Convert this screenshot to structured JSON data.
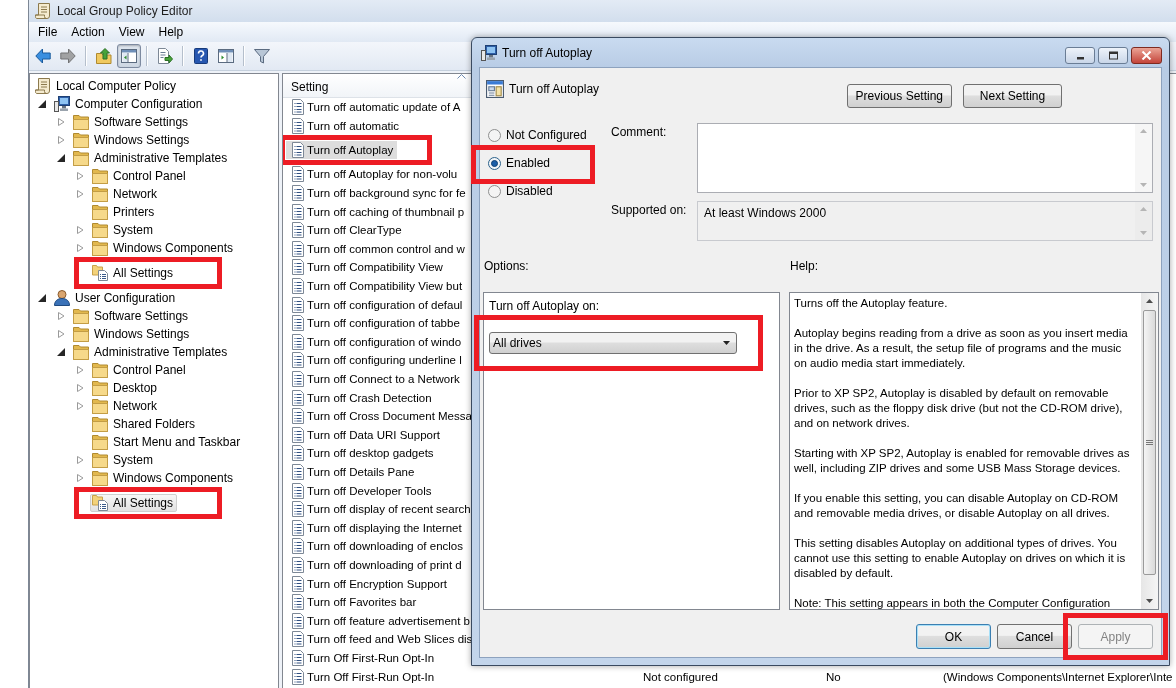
{
  "window": {
    "title": "Local Group Policy Editor"
  },
  "menu": [
    "File",
    "Action",
    "View",
    "Help"
  ],
  "toolbar_groups": [
    [
      {
        "kind": "back",
        "disabled": false,
        "pressed": false
      },
      {
        "kind": "forward",
        "disabled": true,
        "pressed": false
      }
    ],
    [
      {
        "kind": "up",
        "disabled": false,
        "pressed": false
      },
      {
        "kind": "console-tree",
        "disabled": false,
        "pressed": true
      }
    ],
    [
      {
        "kind": "export",
        "disabled": false,
        "pressed": false
      }
    ],
    [
      {
        "kind": "help",
        "disabled": false,
        "pressed": false
      },
      {
        "kind": "action-pane",
        "disabled": false,
        "pressed": false
      }
    ],
    [
      {
        "kind": "filter",
        "disabled": false,
        "pressed": false
      }
    ]
  ],
  "tree": [
    {
      "label": "Local Computer Policy",
      "kind": "policy",
      "selected": false,
      "highlighted": false,
      "children": [
        {
          "label": "Computer Configuration",
          "kind": "computer",
          "expanded": true,
          "selected": false,
          "highlighted": false,
          "children": [
            {
              "label": "Software Settings",
              "kind": "folder",
              "expanded": false,
              "selected": false,
              "highlighted": false
            },
            {
              "label": "Windows Settings",
              "kind": "folder",
              "expanded": false,
              "selected": false,
              "highlighted": false
            },
            {
              "label": "Administrative Templates",
              "kind": "folder",
              "expanded": true,
              "selected": false,
              "highlighted": false,
              "children": [
                {
                  "label": "Control Panel",
                  "kind": "folder",
                  "expanded": false,
                  "selected": false,
                  "highlighted": false
                },
                {
                  "label": "Network",
                  "kind": "folder",
                  "expanded": false,
                  "selected": false,
                  "highlighted": false
                },
                {
                  "label": "Printers",
                  "kind": "folder",
                  "selected": false,
                  "highlighted": false
                },
                {
                  "label": "System",
                  "kind": "folder",
                  "expanded": false,
                  "selected": false,
                  "highlighted": false
                },
                {
                  "label": "Windows Components",
                  "kind": "folder",
                  "expanded": false,
                  "selected": false,
                  "highlighted": false
                },
                {
                  "label": "All Settings",
                  "kind": "all-settings",
                  "selected": false,
                  "highlighted": true
                }
              ]
            }
          ]
        },
        {
          "label": "User Configuration",
          "kind": "user",
          "expanded": true,
          "selected": false,
          "highlighted": false,
          "children": [
            {
              "label": "Software Settings",
              "kind": "folder",
              "expanded": false,
              "selected": false,
              "highlighted": false
            },
            {
              "label": "Windows Settings",
              "kind": "folder",
              "expanded": false,
              "selected": false,
              "highlighted": false
            },
            {
              "label": "Administrative Templates",
              "kind": "folder",
              "expanded": true,
              "selected": false,
              "highlighted": false,
              "children": [
                {
                  "label": "Control Panel",
                  "kind": "folder",
                  "expanded": false,
                  "selected": false,
                  "highlighted": false
                },
                {
                  "label": "Desktop",
                  "kind": "folder",
                  "expanded": false,
                  "selected": false,
                  "highlighted": false
                },
                {
                  "label": "Network",
                  "kind": "folder",
                  "expanded": false,
                  "selected": false,
                  "highlighted": false
                },
                {
                  "label": "Shared Folders",
                  "kind": "folder",
                  "selected": false,
                  "highlighted": false
                },
                {
                  "label": "Start Menu and Taskbar",
                  "kind": "folder",
                  "selected": false,
                  "highlighted": false
                },
                {
                  "label": "System",
                  "kind": "folder",
                  "expanded": false,
                  "selected": false,
                  "highlighted": false
                },
                {
                  "label": "Windows Components",
                  "kind": "folder",
                  "expanded": false,
                  "selected": false,
                  "highlighted": false
                },
                {
                  "label": "All Settings",
                  "kind": "all-settings",
                  "selected": true,
                  "highlighted": true
                }
              ]
            }
          ]
        }
      ]
    }
  ],
  "list": {
    "columns": [
      {
        "label": "Setting",
        "sorted": true
      }
    ],
    "rows": [
      {
        "setting": "Turn off automatic update of A",
        "selected": false,
        "highlighted": false
      },
      {
        "setting": "Turn off automatic",
        "selected": false,
        "highlighted": false
      },
      {
        "setting": "Turn off Autoplay",
        "selected": true,
        "highlighted": true
      },
      {
        "setting": "Turn off Autoplay for non-volu",
        "selected": false,
        "highlighted": false
      },
      {
        "setting": "Turn off background sync for fe",
        "selected": false,
        "highlighted": false
      },
      {
        "setting": "Turn off caching of thumbnail p",
        "selected": false,
        "highlighted": false
      },
      {
        "setting": "Turn off ClearType",
        "selected": false,
        "highlighted": false
      },
      {
        "setting": "Turn off common control and w",
        "selected": false,
        "highlighted": false
      },
      {
        "setting": "Turn off Compatibility View",
        "selected": false,
        "highlighted": false
      },
      {
        "setting": "Turn off Compatibility View but",
        "selected": false,
        "highlighted": false
      },
      {
        "setting": "Turn off configuration of defaul",
        "selected": false,
        "highlighted": false
      },
      {
        "setting": "Turn off configuration of tabbe",
        "selected": false,
        "highlighted": false
      },
      {
        "setting": "Turn off configuration of windo",
        "selected": false,
        "highlighted": false
      },
      {
        "setting": "Turn off configuring underline l",
        "selected": false,
        "highlighted": false
      },
      {
        "setting": "Turn off Connect to a Network",
        "selected": false,
        "highlighted": false
      },
      {
        "setting": "Turn off Crash Detection",
        "selected": false,
        "highlighted": false
      },
      {
        "setting": "Turn off Cross Document Messa",
        "selected": false,
        "highlighted": false
      },
      {
        "setting": "Turn off Data URI Support",
        "selected": false,
        "highlighted": false
      },
      {
        "setting": "Turn off desktop gadgets",
        "selected": false,
        "highlighted": false
      },
      {
        "setting": "Turn off Details Pane",
        "selected": false,
        "highlighted": false
      },
      {
        "setting": "Turn off Developer Tools",
        "selected": false,
        "highlighted": false
      },
      {
        "setting": "Turn off display of recent search",
        "selected": false,
        "highlighted": false
      },
      {
        "setting": "Turn off displaying the Internet",
        "selected": false,
        "highlighted": false
      },
      {
        "setting": "Turn off downloading of enclos",
        "selected": false,
        "highlighted": false
      },
      {
        "setting": "Turn off downloading of print d",
        "selected": false,
        "highlighted": false
      },
      {
        "setting": "Turn off Encryption Support",
        "selected": false,
        "highlighted": false
      },
      {
        "setting": "Turn off Favorites bar",
        "selected": false,
        "highlighted": false
      },
      {
        "setting": "Turn off feature advertisement b",
        "selected": false,
        "highlighted": false
      },
      {
        "setting": "Turn off feed and Web Slices dis",
        "selected": false,
        "highlighted": false
      },
      {
        "setting": "Turn Off First-Run Opt-In",
        "selected": false,
        "highlighted": false
      },
      {
        "setting": "Turn Off First-Run Opt-In",
        "selected": false,
        "highlighted": false,
        "state": "Not configured",
        "comment": "No",
        "path": "(Windows Components\\Internet Explorer\\Inte"
      }
    ]
  },
  "dialog": {
    "title": "Turn off Autoplay",
    "heading": "Turn off Autoplay",
    "nav_buttons": [
      {
        "label": "Previous Setting"
      },
      {
        "label": "Next Setting"
      }
    ],
    "states": [
      {
        "label": "Not Configured",
        "selected": false,
        "highlighted": false
      },
      {
        "label": "Enabled",
        "selected": true,
        "highlighted": true
      },
      {
        "label": "Disabled",
        "selected": false,
        "highlighted": false
      }
    ],
    "comment_label": "Comment:",
    "supported_label": "Supported on:",
    "supported_value": "At least Windows 2000",
    "options_label": "Options:",
    "help_label": "Help:",
    "option": {
      "label": "Turn off Autoplay on:",
      "value": "All drives",
      "highlighted": true
    },
    "help": [
      "Turns off the Autoplay feature.",
      "Autoplay begins reading from a drive as soon as you insert media in the drive. As a result, the setup file of programs and the music on audio media start immediately.",
      "Prior to XP SP2, Autoplay is disabled by default on removable drives, such as the floppy disk drive (but not the CD-ROM drive), and on network drives.",
      "Starting with XP SP2, Autoplay is enabled for removable drives as well, including ZIP drives and some USB Mass Storage devices.",
      "If you enable this setting, you can disable Autoplay on CD-ROM and removable media drives, or disable Autoplay on all drives.",
      "This setting disables Autoplay on additional types of drives. You cannot use this setting to enable Autoplay on drives on which it is disabled by default.",
      "Note: This setting appears in both the Computer Configuration"
    ],
    "buttons": [
      {
        "label": "OK",
        "default": true,
        "disabled": false,
        "highlighted": false
      },
      {
        "label": "Cancel",
        "default": false,
        "disabled": false,
        "highlighted": false
      },
      {
        "label": "Apply",
        "default": false,
        "disabled": true,
        "highlighted": true
      }
    ]
  }
}
